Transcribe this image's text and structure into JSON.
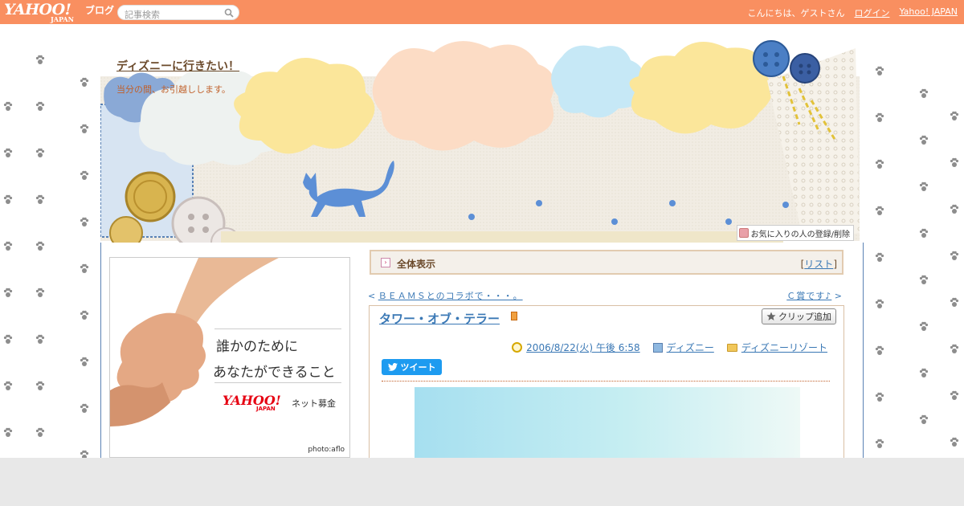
{
  "topbar": {
    "logo_main": "YAHOO!",
    "logo_sub": "JAPAN",
    "logo_blog": "ブログ",
    "search_placeholder": "記事検索",
    "greeting": "こんにちは、ゲストさん",
    "login": "ログイン",
    "yahoo_japan": "Yahoo! JAPAN"
  },
  "header": {
    "title": "ディズニーに行きたい！",
    "description": "当分の間、お引越しします。",
    "favorite_button": "お気に入りの人の登録/削除"
  },
  "ad": {
    "line1": "誰かのために",
    "line2": "あなたができること",
    "logo": "YAHOO!",
    "logo_sub": "JAPAN",
    "label": "ネット募金",
    "credit": "photo:aflo"
  },
  "viewbar": {
    "label": "全体表示",
    "list_prefix": "[",
    "list_link": "リスト",
    "list_suffix": "]"
  },
  "nav": {
    "prev_prefix": "<",
    "prev_label": "ＢＥＡＭＳとのコラボで・・・。",
    "next_label": "Ｃ賞です♪",
    "next_suffix": ">"
  },
  "article": {
    "title": "タワー・オブ・テラー",
    "clip_button": "クリップ追加",
    "date": "2006/8/22(火) 午後 6:58",
    "category": "ディズニー",
    "folder": "ディズニーリゾート",
    "tweet_button": "ツイート"
  },
  "colors": {
    "topbar": "#f98f60",
    "link": "#3a78b5",
    "frame": "#5b82b5",
    "tweet": "#1d9bf0"
  }
}
